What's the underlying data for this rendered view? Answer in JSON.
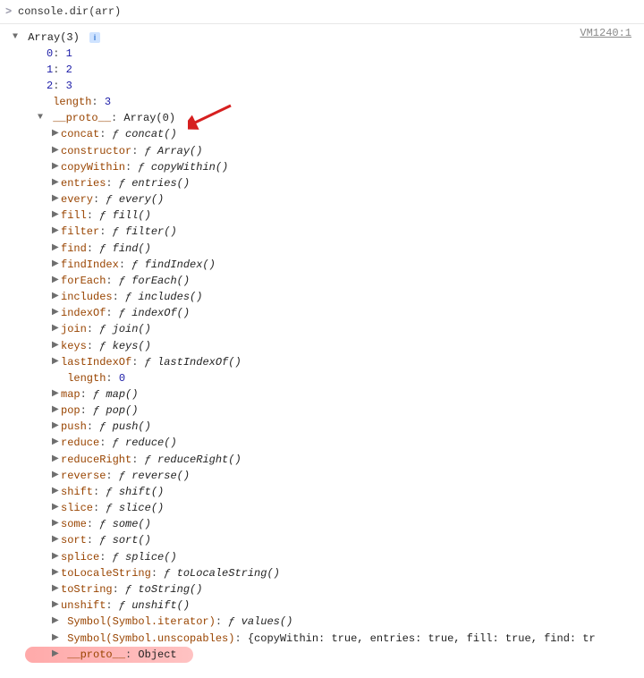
{
  "input": {
    "prompt": ">",
    "code": "console.dir(arr)"
  },
  "source": "VM1240:1",
  "array_header": "Array(3)",
  "info_glyph": "i",
  "indices": [
    {
      "key": "0",
      "value": "1"
    },
    {
      "key": "1",
      "value": "2"
    },
    {
      "key": "2",
      "value": "3"
    }
  ],
  "length_prop": {
    "key": "length",
    "value": "3"
  },
  "proto_header": {
    "key": "__proto__",
    "value": "Array(0)"
  },
  "proto_methods": [
    {
      "name": "concat",
      "sig": "concat()"
    },
    {
      "name": "constructor",
      "sig": "Array()"
    },
    {
      "name": "copyWithin",
      "sig": "copyWithin()"
    },
    {
      "name": "entries",
      "sig": "entries()"
    },
    {
      "name": "every",
      "sig": "every()"
    },
    {
      "name": "fill",
      "sig": "fill()"
    },
    {
      "name": "filter",
      "sig": "filter()"
    },
    {
      "name": "find",
      "sig": "find()"
    },
    {
      "name": "findIndex",
      "sig": "findIndex()"
    },
    {
      "name": "forEach",
      "sig": "forEach()"
    },
    {
      "name": "includes",
      "sig": "includes()"
    },
    {
      "name": "indexOf",
      "sig": "indexOf()"
    },
    {
      "name": "join",
      "sig": "join()"
    },
    {
      "name": "keys",
      "sig": "keys()"
    },
    {
      "name": "lastIndexOf",
      "sig": "lastIndexOf()"
    }
  ],
  "proto_length": {
    "key": "length",
    "value": "0"
  },
  "proto_methods2": [
    {
      "name": "map",
      "sig": "map()"
    },
    {
      "name": "pop",
      "sig": "pop()"
    },
    {
      "name": "push",
      "sig": "push()"
    },
    {
      "name": "reduce",
      "sig": "reduce()"
    },
    {
      "name": "reduceRight",
      "sig": "reduceRight()"
    },
    {
      "name": "reverse",
      "sig": "reverse()"
    },
    {
      "name": "shift",
      "sig": "shift()"
    },
    {
      "name": "slice",
      "sig": "slice()"
    },
    {
      "name": "some",
      "sig": "some()"
    },
    {
      "name": "sort",
      "sig": "sort()"
    },
    {
      "name": "splice",
      "sig": "splice()"
    },
    {
      "name": "toLocaleString",
      "sig": "toLocaleString()"
    },
    {
      "name": "toString",
      "sig": "toString()"
    },
    {
      "name": "unshift",
      "sig": "unshift()"
    }
  ],
  "symbol_iterator": {
    "key": "Symbol(Symbol.iterator)",
    "sig": "values()"
  },
  "symbol_unscopables": {
    "key": "Symbol(Symbol.unscopables)",
    "entries_text": "{copyWithin: true, entries: true, fill: true, find: tr"
  },
  "nested_proto": {
    "key": "__proto__",
    "value": "Object"
  },
  "fn_glyph": "ƒ"
}
